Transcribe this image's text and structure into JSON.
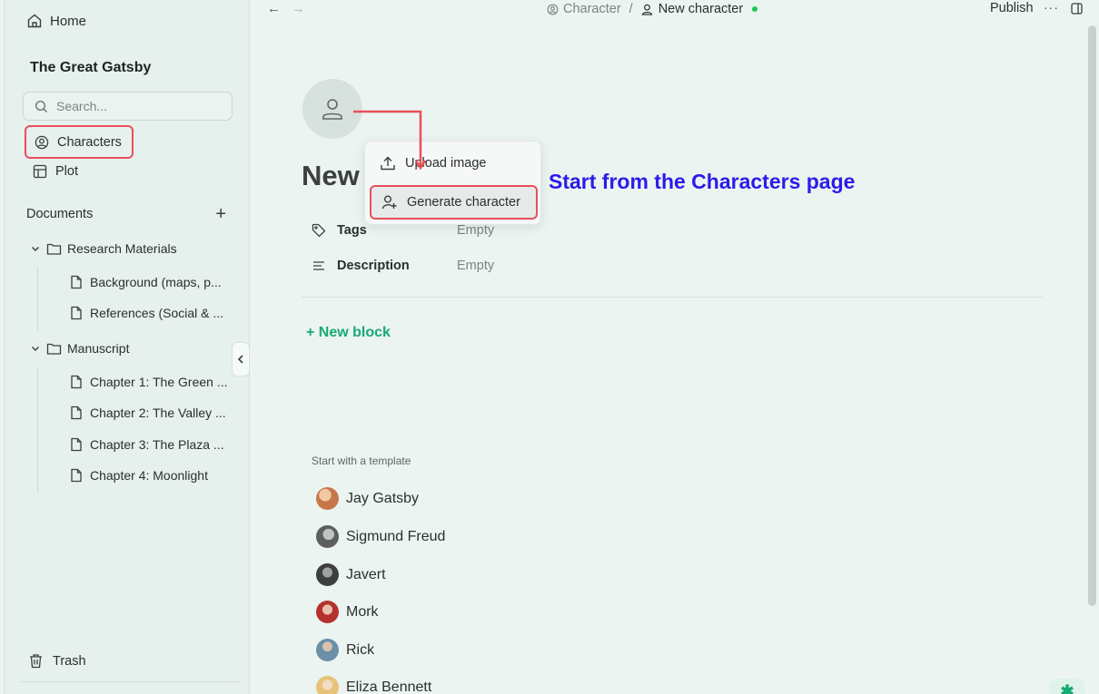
{
  "sidebar": {
    "home_label": "Home",
    "project_title": "The Great Gatsby",
    "search_placeholder": "Search...",
    "items": [
      {
        "label": "Characters"
      },
      {
        "label": "Plot"
      }
    ],
    "documents_label": "Documents",
    "tree": {
      "research": {
        "label": "Research Materials",
        "files": [
          "Background (maps, p...",
          "References (Social & ..."
        ]
      },
      "manuscript": {
        "label": "Manuscript",
        "files": [
          "Chapter 1: The Green ...",
          "Chapter 2: The Valley ...",
          "Chapter 3: The Plaza ...",
          "Chapter 4: Moonlight"
        ]
      }
    },
    "trash_label": "Trash"
  },
  "topbar": {
    "breadcrumb_parent": "Character",
    "breadcrumb_separator": "/",
    "breadcrumb_current": "New character",
    "publish_label": "Publish",
    "more_label": "···"
  },
  "page": {
    "title": "New",
    "properties": [
      {
        "label": "Tags",
        "value": "Empty"
      },
      {
        "label": "Description",
        "value": "Empty"
      }
    ],
    "new_block_label": "+ New block",
    "template_heading": "Start with a template",
    "templates": [
      {
        "name": "Jay Gatsby",
        "color": "#c8774a"
      },
      {
        "name": "Sigmund Freud",
        "color": "#5c5f5e"
      },
      {
        "name": "Javert",
        "color": "#3d3f3f"
      },
      {
        "name": "Mork",
        "color": "#b4322e"
      },
      {
        "name": "Rick",
        "color": "#6a8fa8"
      },
      {
        "name": "Eliza Bennett",
        "color": "#e7c27a"
      }
    ]
  },
  "menu": {
    "upload_label": "Upload image",
    "generate_label": "Generate character"
  },
  "annotation": {
    "text": "Start from the Characters page"
  },
  "colors": {
    "accent_green": "#17a974",
    "highlight_red": "#e8505b",
    "annotation_blue": "#2b1bea"
  }
}
